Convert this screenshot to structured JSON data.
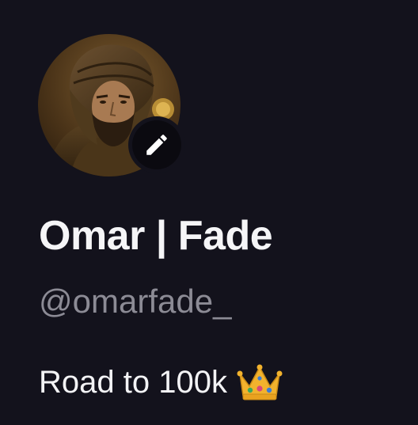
{
  "profile": {
    "display_name": "Omar | Fade",
    "handle": "@omarfade_",
    "bio": "Road to 100k",
    "bio_emoji": "crown-icon",
    "avatar_icon": "avatar-image",
    "edit_icon": "pencil-icon"
  },
  "colors": {
    "background": "#13121c",
    "name_text": "#f5f5f7",
    "handle_text": "#8c8b95",
    "edit_button_bg": "#0b0a10",
    "crown_gold": "#f2b22d"
  }
}
